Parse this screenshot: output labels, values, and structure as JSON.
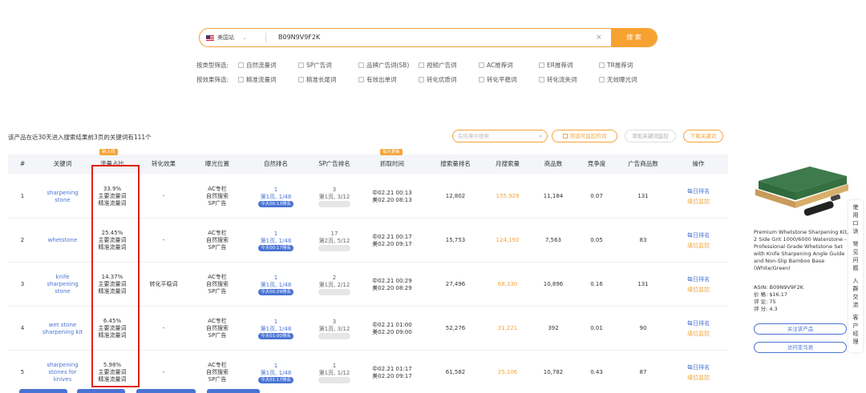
{
  "search": {
    "country": "美国站",
    "query": "B09N9V9F2K",
    "clear_icon": "×",
    "button_label": "搜 索"
  },
  "filters": {
    "type_label": "按类型筛选:",
    "type_options": [
      "自然流量词",
      "SP广告词",
      "品牌广告词(SB)",
      "视频广告词",
      "AC推荐词",
      "ER推荐词",
      "TR推荐词"
    ],
    "effect_label": "按效果筛选:",
    "effect_options": [
      "精准流量词",
      "精准长尾词",
      "有效出单词",
      "转化优质词",
      "转化平稳词",
      "转化流失词",
      "无效曝光词"
    ]
  },
  "summary": "该产品在近30天进入搜索结果前3页的关键词有111个",
  "toolbar": {
    "search_placeholder": "在结果中搜索",
    "monitor_label": "筛选可监控的词",
    "add_monitor_label": "添加关键词监控",
    "download_label": "下载关键词"
  },
  "table": {
    "headers": [
      "#",
      "关键词",
      "流量占比",
      "转化效果",
      "曝光位置",
      "自然排名",
      "SP广告排名",
      "抓取时间",
      "搜索量排名",
      "月搜索量",
      "商品数",
      "竞争度",
      "广告商品数",
      "操作"
    ],
    "tag_new": "新上线",
    "tag_update": "每天更新",
    "rows": [
      {
        "idx": "1",
        "keyword": "sharpening stone",
        "share": "33.9%",
        "share_1": "主要流量词",
        "share_2": "精准流量词",
        "conv": "-",
        "pos_1": "AC专栏",
        "pos_2": "自然搜索",
        "pos_3": "SP广告",
        "nat_1": "1",
        "nat_2": "第1页, 1/48",
        "nat_3": "今天00:13排名",
        "sp_1": "3",
        "sp_2": "第1页, 3/12",
        "time_1": "中02.21 00:13",
        "time_2": "美02.20 08:13",
        "rank": "12,802",
        "monthly": "155,929",
        "products": "11,184",
        "comp": "0.07",
        "ads": "131",
        "act_1": "每日排名",
        "act_2": "填位监控"
      },
      {
        "idx": "2",
        "keyword": "whetstone",
        "share": "25.45%",
        "share_1": "主要流量词",
        "share_2": "精准流量词",
        "conv": "-",
        "pos_1": "AC专栏",
        "pos_2": "自然搜索",
        "pos_3": "SP广告",
        "nat_1": "1",
        "nat_2": "第1页, 1/48",
        "nat_3": "今天00:17排名",
        "sp_1": "17",
        "sp_2": "第2页, 5/12",
        "time_1": "中02.21 00:17",
        "time_2": "美02.20 09:17",
        "rank": "15,753",
        "monthly": "124,192",
        "products": "7,563",
        "comp": "0.05",
        "ads": "83",
        "act_1": "每日排名",
        "act_2": "填位监控"
      },
      {
        "idx": "3",
        "keyword": "knife sharpening stone",
        "share": "14.37%",
        "share_1": "主要流量词",
        "share_2": "精准流量词",
        "conv": "转化平稳词",
        "pos_1": "AC专栏",
        "pos_2": "自然搜索",
        "pos_3": "SP广告",
        "nat_1": "1",
        "nat_2": "第1页, 1/48",
        "nat_3": "今天00:29排名",
        "sp_1": "2",
        "sp_2": "第1页, 2/12",
        "time_1": "中02.21 00:29",
        "time_2": "美02.20 08:29",
        "rank": "27,496",
        "monthly": "68,330",
        "products": "10,896",
        "comp": "0.16",
        "ads": "131",
        "act_1": "每日排名",
        "act_2": "填位监控"
      },
      {
        "idx": "4",
        "keyword": "wet stone sharpening kit",
        "share": "6.45%",
        "share_1": "主要流量词",
        "share_2": "精准流量词",
        "conv": "-",
        "pos_1": "AC专栏",
        "pos_2": "自然搜索",
        "pos_3": "SP广告",
        "nat_1": "1",
        "nat_2": "第1页, 1/48",
        "nat_3": "今天01:00排名",
        "sp_1": "3",
        "sp_2": "第1页, 3/12",
        "time_1": "中02.21 01:00",
        "time_2": "美02.20 09:00",
        "rank": "52,276",
        "monthly": "31,221",
        "products": "392",
        "comp": "0.01",
        "ads": "90",
        "act_1": "每日排名",
        "act_2": "填位监控"
      },
      {
        "idx": "5",
        "keyword": "sharpening stones for knives",
        "share": "5.98%",
        "share_1": "主要流量词",
        "share_2": "精准流量词",
        "conv": "-",
        "pos_1": "AC专栏",
        "pos_2": "自然搜索",
        "pos_3": "SP广告",
        "nat_1": "1",
        "nat_2": "第1页, 1/48",
        "nat_3": "今天01:17排名",
        "sp_1": "1",
        "sp_2": "第1页, 1/12",
        "time_1": "中02.21 01:17",
        "time_2": "美02.20 09:17",
        "rank": "61,582",
        "monthly": "25,106",
        "products": "10,782",
        "comp": "0.43",
        "ads": "87",
        "act_1": "每日排名",
        "act_2": "填位监控"
      }
    ]
  },
  "product": {
    "title": "Premium Whetstone Sharpening Kit, 2 Side Grit 1000/6000 Waterstone - Professional Grade Whetstone Set with Knife Sharpening Angle Guide and Non-Slip Bamboo Base (White/Green)",
    "asin": "ASIN:   B09N9V9F2K",
    "price": "价 格:   $16.17",
    "reviews": "评 论:   75",
    "rating": "评 分:   4.3",
    "follow_label": "关注该产品",
    "visit_label": "访问亚马逊"
  },
  "sidetab": {
    "item1": "使用口诀",
    "item2": "常见问题",
    "item3": "入群交流",
    "item4": "客户经理"
  },
  "colors": {
    "accent": "#f4a338",
    "link": "#4a74d4",
    "highlight_box": "#e0201b"
  }
}
